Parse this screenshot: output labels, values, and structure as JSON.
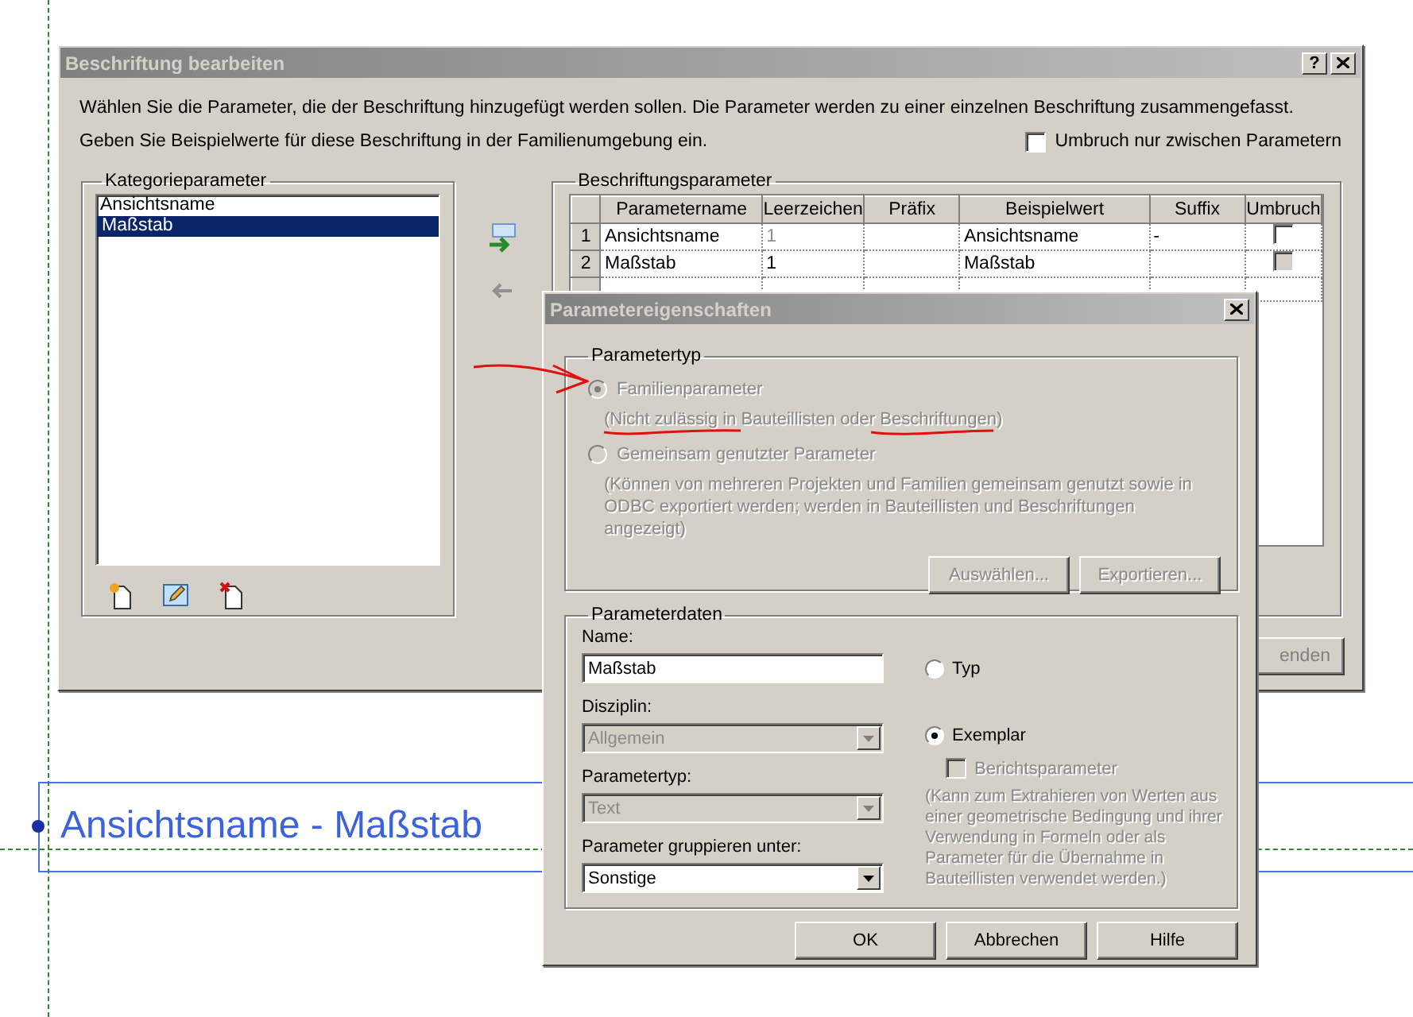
{
  "main_dialog": {
    "title": "Beschriftung bearbeiten",
    "help_button": "?",
    "instructions": [
      "Wählen Sie die Parameter, die der Beschriftung hinzugefügt werden sollen. Die Parameter werden zu einer einzelnen Beschriftung zusammengefasst.",
      "Geben Sie Beispielwerte für diese Beschriftung in der Familienumgebung ein."
    ],
    "wrap_option": {
      "label": "Umbruch nur zwischen Parametern",
      "checked": false
    },
    "category_parameters": {
      "title": "Kategorieparameter",
      "items": [
        {
          "label": "Ansichtsname",
          "selected": false
        },
        {
          "label": "Maßstab",
          "selected": true
        }
      ]
    },
    "label_parameters": {
      "title": "Beschriftungsparameter",
      "columns": [
        "Parametername",
        "Leerzeichen",
        "Präfix",
        "Beispielwert",
        "Suffix",
        "Umbruch"
      ],
      "rows": [
        {
          "number": "1",
          "name": "Ansichtsname",
          "spaces": "1",
          "spaces_disabled": true,
          "sample": "Ansichtsname",
          "suffix": "-",
          "wrap": false,
          "wrap_disabled": false
        },
        {
          "number": "2",
          "name": "Maßstab",
          "spaces": "1",
          "spaces_disabled": false,
          "sample": "Maßstab",
          "wrap": false,
          "wrap_disabled": true
        }
      ]
    },
    "partial_button": "enden"
  },
  "properties_dialog": {
    "title": "Parametereigenschaften",
    "parameter_type": {
      "title": "Parametertyp",
      "options": [
        {
          "label": "Familienparameter",
          "selected": true,
          "disabled": true,
          "note": "(Nicht zulässig in Bauteillisten oder Beschriftungen)"
        },
        {
          "label": "Gemeinsam genutzter Parameter",
          "selected": false,
          "disabled": true,
          "note": "(Können von mehreren Projekten und Familien gemeinsam genutzt sowie in ODBC exportiert werden; werden in Bauteillisten und Beschriftungen angezeigt)"
        }
      ],
      "buttons": [
        {
          "label": "Auswählen...",
          "disabled": true
        },
        {
          "label": "Exportieren...",
          "disabled": true
        }
      ]
    },
    "parameter_data": {
      "title": "Parameterdaten",
      "name": {
        "label": "Name:",
        "value": "Maßstab"
      },
      "fields": [
        {
          "label": "Disziplin:",
          "value": "Allgemein",
          "disabled": true
        },
        {
          "label": "Parametertyp:",
          "value": "Text",
          "disabled": true
        },
        {
          "label": "Parameter gruppieren unter:",
          "value": "Sonstige",
          "disabled": false
        }
      ],
      "instance_options": [
        {
          "label": "Typ",
          "selected": false
        },
        {
          "label": "Exemplar",
          "selected": true
        }
      ],
      "report_parameter": {
        "label": "Berichtsparameter",
        "checked": false,
        "disabled": true
      },
      "note": "(Kann zum Extrahieren von Werten aus einer geometrische Bedingung und ihrer Verwendung in Formeln oder als Parameter für die Übernahme in Bauteillisten verwendet werden.)"
    },
    "buttons": [
      "OK",
      "Abbrechen",
      "Hilfe"
    ]
  },
  "canvas": {
    "label_text": "Ansichtsname - Maßstab"
  }
}
